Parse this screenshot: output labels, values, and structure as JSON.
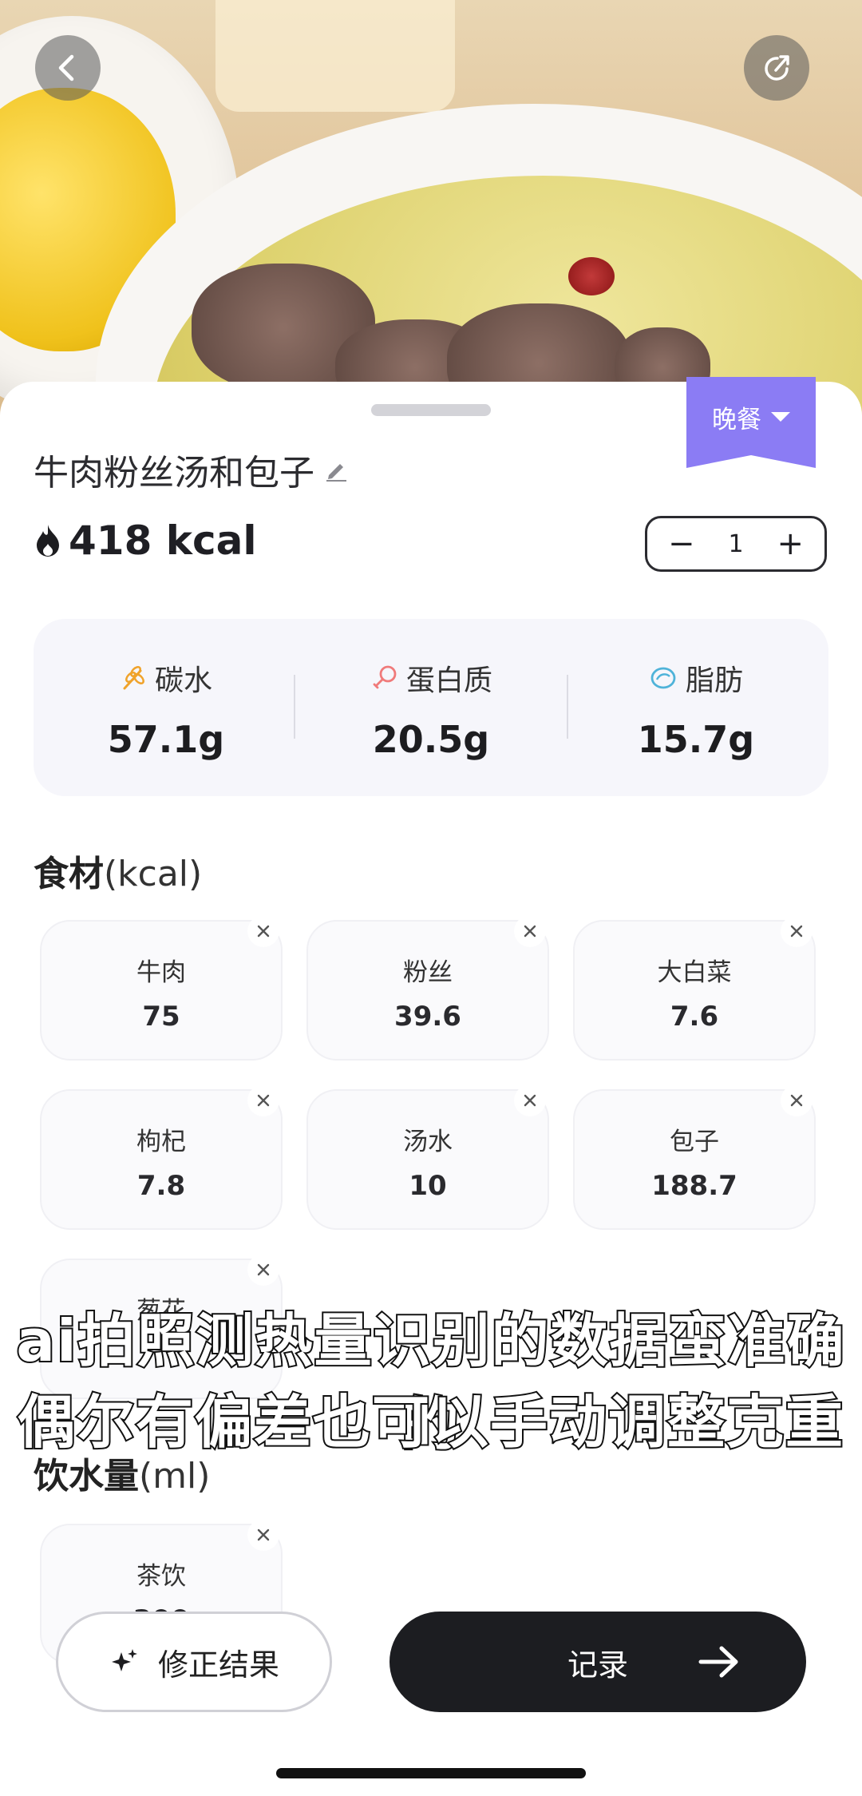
{
  "meal_tag": "晚餐",
  "dish_name": "牛肉粉丝汤和包子",
  "calories": "418 kcal",
  "portion": "1",
  "macros": [
    {
      "label": "碳水",
      "value": "57.1g",
      "icon": "wheat-icon",
      "color": "#f0a32b"
    },
    {
      "label": "蛋白质",
      "value": "20.5g",
      "icon": "drumstick-icon",
      "color": "#f07a7a"
    },
    {
      "label": "脂肪",
      "value": "15.7g",
      "icon": "oil-drop-icon",
      "color": "#4fb3d9"
    }
  ],
  "ingredients_section": {
    "title": "食材",
    "unit": "(kcal)"
  },
  "ingredients": [
    {
      "name": "牛肉",
      "value": "75"
    },
    {
      "name": "粉丝",
      "value": "39.6"
    },
    {
      "name": "大白菜",
      "value": "7.6"
    },
    {
      "name": "枸杞",
      "value": "7.8"
    },
    {
      "name": "汤水",
      "value": "10"
    },
    {
      "name": "包子",
      "value": "188.7"
    },
    {
      "name": "葱花",
      "value": ""
    }
  ],
  "water_section": {
    "title": "饮水量",
    "unit": "(ml)"
  },
  "water_items": [
    {
      "name": "茶饮",
      "value": "300"
    }
  ],
  "overlay_caption": {
    "line1": "ai拍照测热量识别的数据蛮准确的",
    "line2": "偶尔有偏差也可以手动调整克重"
  },
  "buttons": {
    "correct": "修正结果",
    "record": "记录"
  },
  "colors": {
    "accent": "#8b7cf4",
    "dark_button": "#1c1d21"
  }
}
